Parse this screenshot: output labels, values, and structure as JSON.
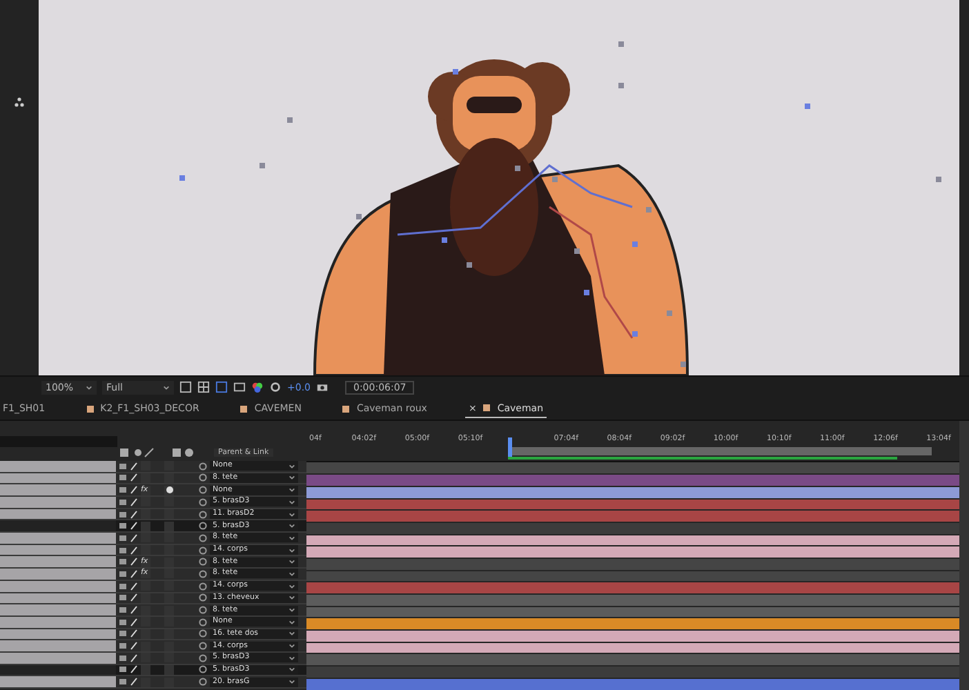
{
  "viewer_toolbar": {
    "zoom": "100%",
    "resolution": "Full",
    "exposure": "+0.0",
    "timecode": "0:00:06:07"
  },
  "tabs": [
    {
      "label": "F1_SH01",
      "selected": false,
      "closable": false
    },
    {
      "label": "K2_F1_SH03_DECOR",
      "selected": false,
      "closable": false
    },
    {
      "label": "CAVEMEN",
      "selected": false,
      "closable": false
    },
    {
      "label": "Caveman roux",
      "selected": false,
      "closable": false
    },
    {
      "label": "Caveman",
      "selected": true,
      "closable": true
    }
  ],
  "close_glyph": "×",
  "parent_column": "Parent & Link",
  "ruler": [
    "04f",
    "04:02f",
    "05:00f",
    "05:10f",
    "07:04f",
    "08:04f",
    "09:02f",
    "10:00f",
    "10:10f",
    "11:00f",
    "12:06f",
    "13:04f"
  ],
  "layers": [
    {
      "parent": "None",
      "motion_blur": false,
      "selected": false,
      "color": "#464646"
    },
    {
      "parent": "8. tete",
      "motion_blur": false,
      "selected": false,
      "color": "#7a4a86"
    },
    {
      "parent": "None",
      "fx": "fx",
      "motion_blur": true,
      "selected": false,
      "color": "#8d9ad6"
    },
    {
      "parent": "5. brasD3",
      "motion_blur": false,
      "selected": false,
      "color": "#a84545"
    },
    {
      "parent": "11. brasD2",
      "motion_blur": false,
      "selected": false,
      "color": "#a84545"
    },
    {
      "parent": "5. brasD3",
      "motion_blur": false,
      "selected": true,
      "color": "#3c3c3c"
    },
    {
      "parent": "8. tete",
      "motion_blur": false,
      "selected": false,
      "color": "#d4a9b7"
    },
    {
      "parent": "14. corps",
      "motion_blur": false,
      "selected": false,
      "color": "#d4a9b7"
    },
    {
      "parent": "8. tete",
      "fx": "fx",
      "motion_blur": false,
      "selected": false,
      "color": "#454545"
    },
    {
      "parent": "8. tete",
      "fx": "fx",
      "motion_blur": false,
      "selected": false,
      "color": "#454545"
    },
    {
      "parent": "14. corps",
      "motion_blur": false,
      "selected": false,
      "color": "#a84545"
    },
    {
      "parent": "13. cheveux",
      "motion_blur": false,
      "selected": false,
      "color": "#5c5c5c"
    },
    {
      "parent": "8. tete",
      "motion_blur": false,
      "selected": false,
      "color": "#5c5c5c"
    },
    {
      "parent": "None",
      "motion_blur": false,
      "selected": false,
      "color": "#d98a26"
    },
    {
      "parent": "16. tete dos",
      "motion_blur": false,
      "selected": false,
      "color": "#d4a9b7"
    },
    {
      "parent": "14. corps",
      "motion_blur": false,
      "selected": false,
      "color": "#d4a9b7"
    },
    {
      "parent": "5. brasD3",
      "motion_blur": false,
      "selected": false,
      "color": "#555555"
    },
    {
      "parent": "5. brasD3",
      "motion_blur": false,
      "selected": true,
      "color": "#3c3c3c"
    },
    {
      "parent": "20. brasG",
      "motion_blur": false,
      "selected": false,
      "color": "#5670d0"
    }
  ]
}
